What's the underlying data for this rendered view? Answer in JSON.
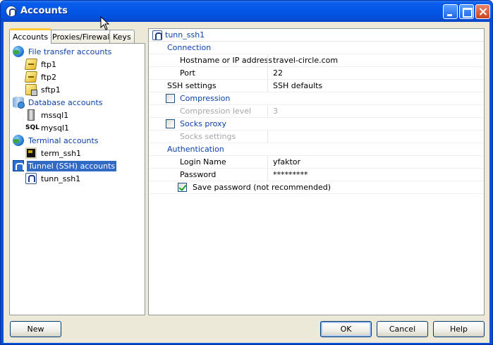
{
  "window": {
    "title": "Accounts"
  },
  "tabs": [
    {
      "label": "Accounts",
      "active": true
    },
    {
      "label": "Proxies/Firewalls",
      "active": false
    },
    {
      "label": "Keys",
      "active": false
    }
  ],
  "tree": {
    "groups": [
      {
        "label": "File transfer accounts",
        "icon": "globe-icon",
        "items": [
          {
            "label": "ftp1",
            "icon": "ftp-icon"
          },
          {
            "label": "ftp2",
            "icon": "ftp-icon"
          },
          {
            "label": "sftp1",
            "icon": "sftp-icon"
          }
        ]
      },
      {
        "label": "Database accounts",
        "icon": "database-icon",
        "items": [
          {
            "label": "mssql1",
            "icon": "server-icon"
          },
          {
            "label": "mysql1",
            "icon": "sql-icon"
          }
        ]
      },
      {
        "label": "Terminal accounts",
        "icon": "globe-icon",
        "items": [
          {
            "label": "term_ssh1",
            "icon": "terminal-icon"
          }
        ]
      },
      {
        "label": "Tunnel (SSH) accounts",
        "icon": "tunnel-folder-icon",
        "selected": true,
        "items": [
          {
            "label": "tunn_ssh1",
            "icon": "tunnel-icon"
          }
        ]
      }
    ]
  },
  "properties": {
    "header": "tunn_ssh1",
    "connection_section": "Connection",
    "hostname_label": "Hostname or IP address",
    "hostname_value": "travel-circle.com",
    "port_label": "Port",
    "port_value": "22",
    "ssh_settings_label": "SSH settings",
    "ssh_settings_value": "SSH defaults",
    "compression_label": "Compression",
    "compression_checked": false,
    "compression_level_label": "Compression level",
    "compression_level_value": "3",
    "socks_proxy_label": "Socks proxy",
    "socks_proxy_checked": false,
    "socks_settings_label": "Socks settings",
    "socks_settings_value": "",
    "authentication_section": "Authentication",
    "login_label": "Login Name",
    "login_value": "yfaktor",
    "password_label": "Password",
    "password_value": "*********",
    "save_password_label": "Save password (not recommended)",
    "save_password_checked": true
  },
  "buttons": {
    "new": "New",
    "ok": "OK",
    "cancel": "Cancel",
    "help": "Help"
  }
}
